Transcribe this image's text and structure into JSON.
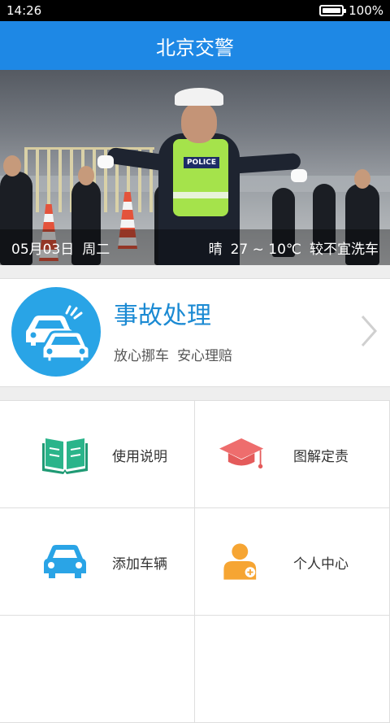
{
  "status_bar": {
    "time": "14:26",
    "battery": "100%"
  },
  "app_bar": {
    "title": "北京交警"
  },
  "banner": {
    "date": "05月03日",
    "weekday": "周二",
    "weather": "晴",
    "temperature": "27 ~ 10℃",
    "car_wash": "较不宜洗车",
    "police_label": "POLICE",
    "active_slide": 3,
    "slide_count": 3
  },
  "accident": {
    "title": "事故处理",
    "subtitle_1": "放心挪车",
    "subtitle_2": "安心理赔",
    "icon": "two-cars-icon",
    "color": "#29a4e6"
  },
  "grid": {
    "items": [
      {
        "label": "使用说明",
        "icon": "book-icon",
        "color": "#2ab48a"
      },
      {
        "label": "图解定责",
        "icon": "graduation-cap-icon",
        "color": "#ee6d6d"
      },
      {
        "label": "添加车辆",
        "icon": "car-icon",
        "color": "#2aa4e6"
      },
      {
        "label": "个人中心",
        "icon": "person-icon",
        "color": "#f6a533"
      }
    ]
  },
  "colors": {
    "primary": "#1e88e5",
    "accent_text": "#1b8ad3"
  }
}
